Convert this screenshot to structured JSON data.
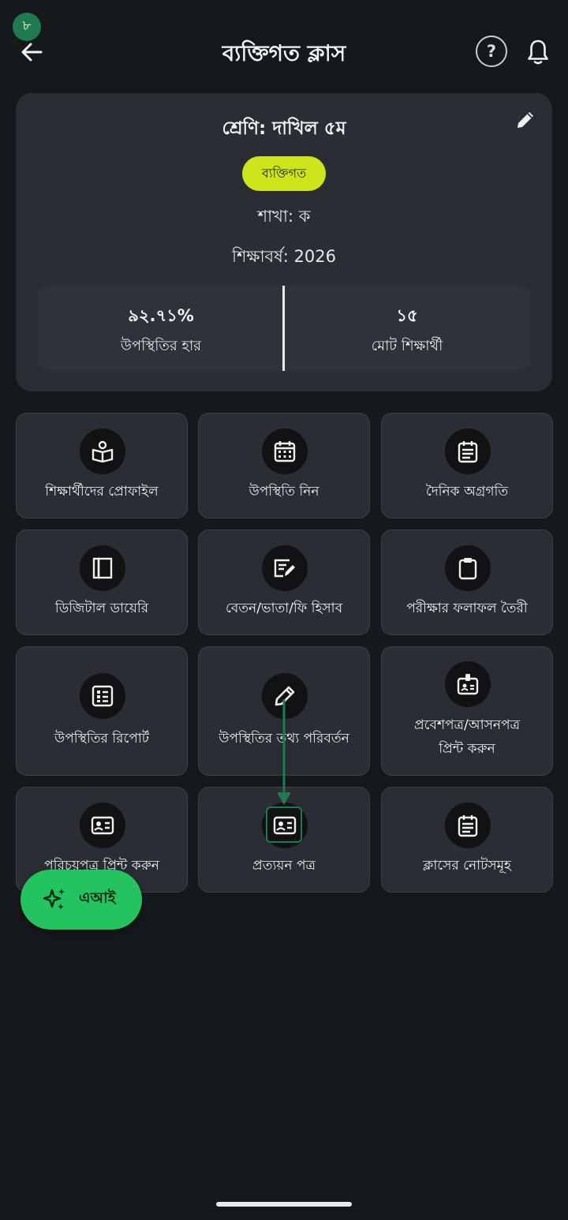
{
  "step_badge": "৮",
  "header": {
    "title": "ব্যক্তিগত ক্লাস",
    "help_label": "?"
  },
  "class_card": {
    "title": "শ্রেণি: দাখিল ৫ম",
    "type_chip": "ব্যক্তিগত",
    "section": "শাখা: ক",
    "academic_year": "শিক্ষাবর্ষ: 2026",
    "stats": {
      "attendance_rate_value": "৯২.৭১%",
      "attendance_rate_label": "উপস্থিতির হার",
      "total_students_value": "১৫",
      "total_students_label": "মোট শিক্ষার্থী"
    }
  },
  "tiles": [
    {
      "label": "শিক্ষার্থীদের প্রোফাইল",
      "icon": "book-user-icon"
    },
    {
      "label": "উপস্থিতি নিন",
      "icon": "calendar-grid-icon"
    },
    {
      "label": "দৈনিক অগ্রগতি",
      "icon": "calendar-notes-icon"
    },
    {
      "label": "ডিজিটাল ডায়েরি",
      "icon": "diary-books-icon"
    },
    {
      "label": "বেতন/ভাতা/ফি হিসাব",
      "icon": "edit-list-icon"
    },
    {
      "label": "পরীক্ষার ফলাফল তৈরী",
      "icon": "clipboard-icon"
    },
    {
      "label": "উপস্থিতির রিপোর্ট",
      "icon": "report-list-icon"
    },
    {
      "label": "উপস্থিতির তথ্য পরিবর্তন",
      "icon": "pencil-icon"
    },
    {
      "label_line1": "প্রবেশপত্র/আসনপত্র",
      "label_line2": "প্রিন্ট করুন",
      "icon": "badge-id-icon"
    },
    {
      "label": "পরিচয়পত্র প্রিন্ট করুন",
      "icon": "id-card-icon"
    },
    {
      "label": "প্রত্যয়ন পত্র",
      "icon": "id-card-icon"
    },
    {
      "label": "ক্লাসের নোটসমূহ",
      "icon": "calendar-notes-icon"
    }
  ],
  "ai_fab": {
    "label": "এআই",
    "icon": "sparkles-icon"
  },
  "colors": {
    "background": "#16191c",
    "card": "#2a2d33",
    "chip": "#cde61b",
    "fab": "#23c45f",
    "annotation": "#1f7a4f"
  }
}
